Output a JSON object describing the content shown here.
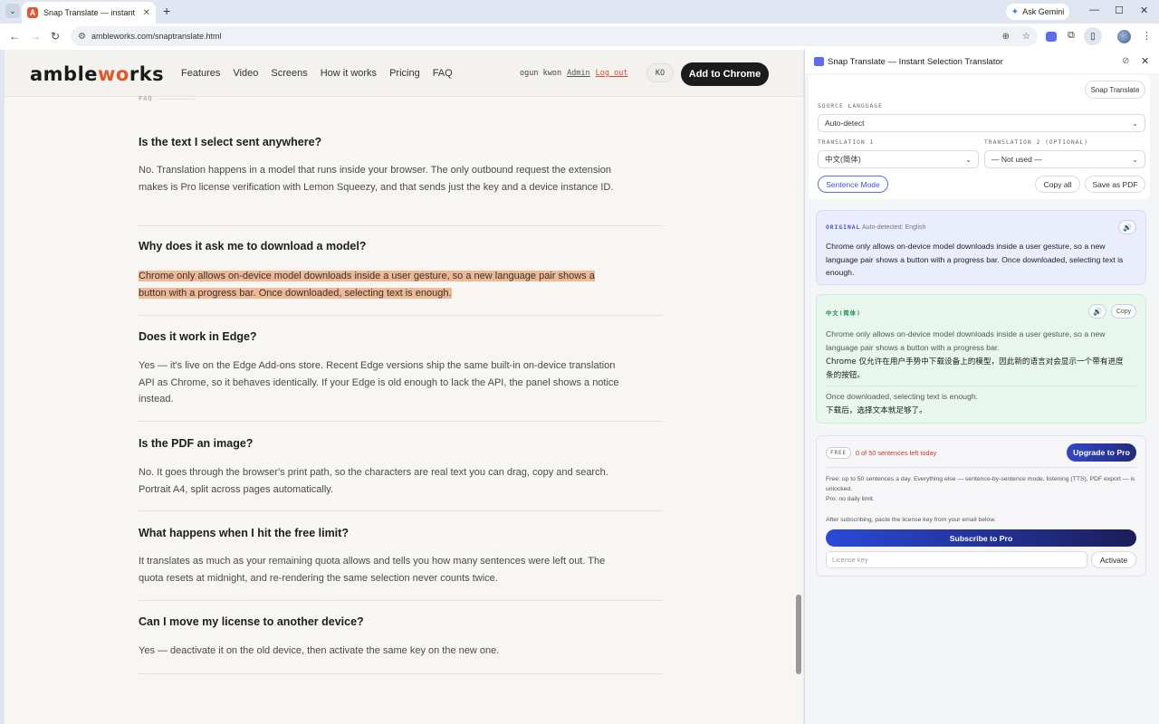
{
  "browser": {
    "tab_title": "Snap Translate — instant selecti",
    "tab_favicon": "A",
    "url": "ambleworks.com/snaptranslate.html",
    "gemini_label": "Ask Gemini"
  },
  "site": {
    "logo_left": "amble",
    "logo_mid": "wo",
    "logo_right": "rks",
    "nav": [
      "Features",
      "Video",
      "Screens",
      "How it works",
      "Pricing",
      "FAQ"
    ],
    "user_name": "ogun kwon",
    "admin_link": "Admin",
    "logout_link": "Log out",
    "user_initials": "KO",
    "cta": "Add to Chrome"
  },
  "faq": {
    "eyebrow": "FAQ",
    "items": [
      {
        "q": "Is the text I select sent anywhere?",
        "a": "No. Translation happens in a model that runs inside your browser. The only outbound request the extension makes is Pro license verification with Lemon Squeezy, and that sends just the key and a device instance ID."
      },
      {
        "q": "Why does it ask me to download a model?",
        "a": "Chrome only allows on-device model downloads inside a user gesture, so a new language pair shows a button with a progress bar. Once downloaded, selecting text is enough."
      },
      {
        "q": "Does it work in Edge?",
        "a": "Yes — it's live on the Edge Add-ons store. Recent Edge versions ship the same built-in on-device translation API as Chrome, so it behaves identically. If your Edge is old enough to lack the API, the panel shows a notice instead."
      },
      {
        "q": "Is the PDF an image?",
        "a": "No. It goes through the browser's print path, so the characters are real text you can drag, copy and search. Portrait A4, split across pages automatically."
      },
      {
        "q": "What happens when I hit the free limit?",
        "a": "It translates as much as your remaining quota allows and tells you how many sentences were left out. The quota resets at midnight, and re-rendering the same selection never counts twice."
      },
      {
        "q": "Can I move my license to another device?",
        "a": "Yes — deactivate it on the old device, then activate the same key on the new one."
      }
    ]
  },
  "panel": {
    "title": "Snap Translate — Instant Selection Translator",
    "snap_button": "Snap Translate",
    "source_label": "SOURCE LANGUAGE",
    "source_value": "Auto-detect",
    "t1_label": "TRANSLATION 1",
    "t1_value": "中文(简体)",
    "t2_label": "TRANSLATION 2 (OPTIONAL)",
    "t2_value": "— Not used —",
    "sentence_mode": "Sentence Mode",
    "copy_all": "Copy all",
    "save_pdf": "Save as PDF",
    "original": {
      "tag": "ORIGINAL",
      "detected": "Auto-detected: English",
      "text": "Chrome only allows on-device model downloads inside a user gesture, so a new language pair shows a button with a progress bar. Once downloaded, selecting text is enough."
    },
    "translation": {
      "tag": "中文(简体)",
      "copy": "Copy",
      "sentences": [
        {
          "src": "Chrome only allows on-device model downloads inside a user gesture, so a new language pair shows a button with a progress bar.",
          "dst": "Chrome 仅允许在用户手势中下载设备上的模型，因此新的语言对会显示一个带有进度条的按钮。"
        },
        {
          "src": "Once downloaded, selecting text is enough.",
          "dst": "下载后，选择文本就足够了。"
        }
      ]
    },
    "free": {
      "badge": "FREE",
      "quota": "0 of 50 sentences left today",
      "upgrade": "Upgrade to Pro",
      "line1": "Free: up to 50 sentences a day. Everything else — sentence-by-sentence mode, listening (TTS), PDF export — is unlocked.",
      "line2": "Pro: no daily limit.",
      "line3": "After subscribing, paste the license key from your email below.",
      "subscribe": "Subscribe to Pro",
      "license_placeholder": "License key",
      "activate": "Activate"
    }
  },
  "colors": {
    "accent": "#e2572b",
    "highlight": "#efb995",
    "panel_blue": "#5b6cf0"
  }
}
